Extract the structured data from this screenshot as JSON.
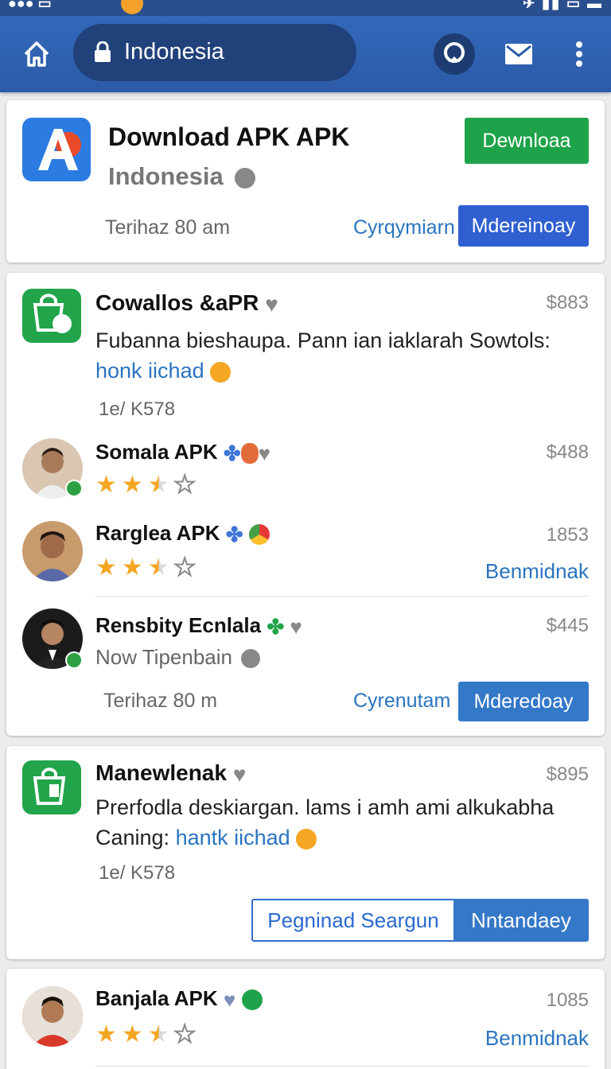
{
  "toolbar": {
    "url": "Indonesia"
  },
  "top_card": {
    "title": "Download APK APK",
    "subtitle": "Indonesia",
    "meta": "Terihaz 80 am",
    "download_label": "Dewnloaa",
    "link_label": "Cyrqymiarn",
    "action_label": "Mdereinoay"
  },
  "feed_card": {
    "title": "Cowallos &aPR",
    "price": "$883",
    "desc": "Fubanna bieshaupa. Pann ian iaklarah Sowtols:",
    "link": "honk iichad",
    "meta": "1e/ K578",
    "items": [
      {
        "title": "Somala APK",
        "price": "$488",
        "rating": "2.5 of 5"
      },
      {
        "title": "Rarglea APK",
        "price": "1853",
        "link": "Benmidnak",
        "rating": "2.5 of 5"
      },
      {
        "title": "Rensbity Ecnlala",
        "price": "$445",
        "subtitle": "Now  Tipenbain",
        "meta": "Terihaz 80 m",
        "link_label": "Cyrenutam",
        "action_label": "Mderedoay"
      }
    ]
  },
  "card3": {
    "title": "Manewlenak",
    "price": "$895",
    "desc_line1": "Prerfodla deskiargan. lams i amh ami alkukabha",
    "desc_prefix": "Caning: ",
    "link": "hantk iichad",
    "meta": "1e/ K578",
    "secondary_label": "Pegninad Seargun",
    "primary_label": "Nntandaey"
  },
  "card4": {
    "title": "Banjala APK",
    "price": "1085",
    "link": "Benmidnak",
    "rating": "2.5 of 5"
  },
  "colors": {
    "toolbar": "#2b5ba8",
    "green": "#1fa34a",
    "blue_button": "#2f5fd0",
    "link": "#2a74c0"
  }
}
